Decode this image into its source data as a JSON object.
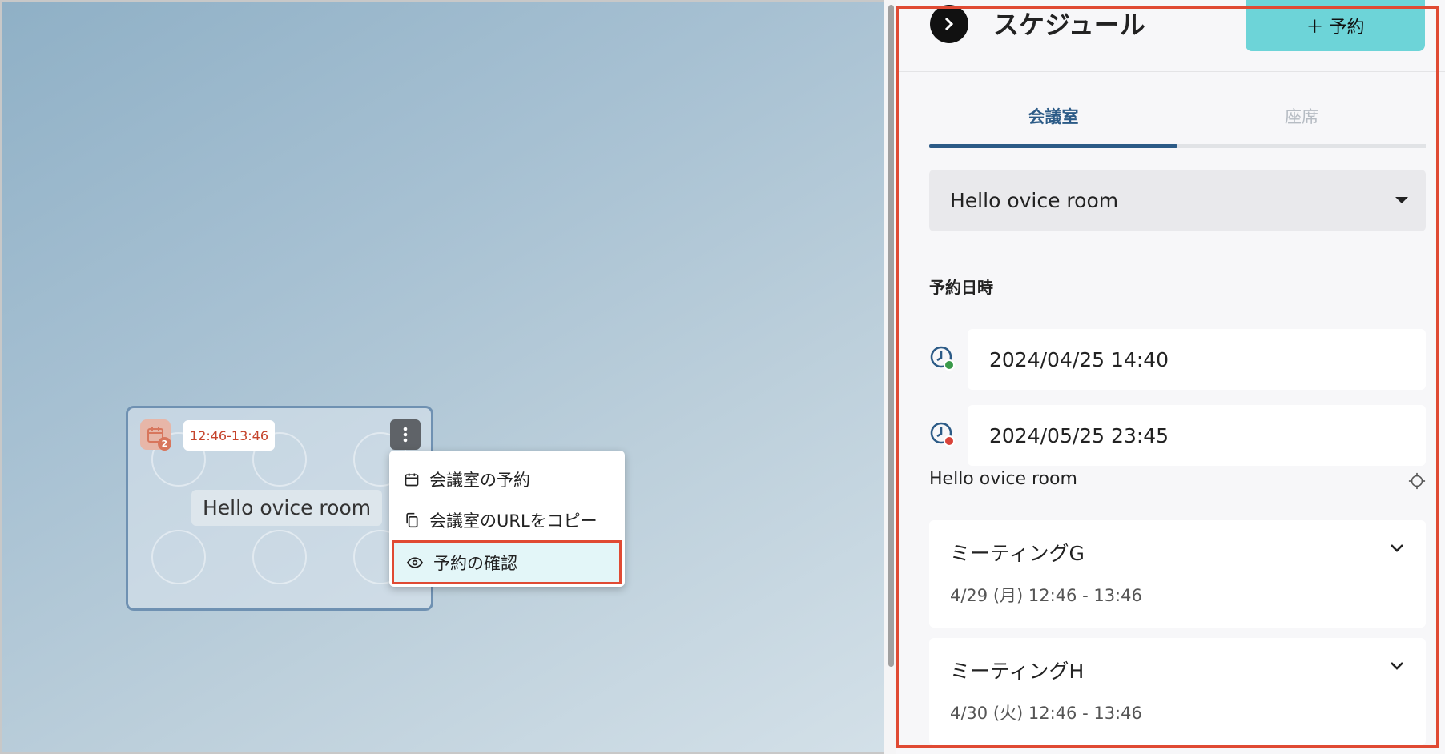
{
  "canvas": {
    "room_card": {
      "badge_count": "2",
      "time_range": "12:46-13:46",
      "room_name": "Hello ovice room"
    },
    "context_menu": {
      "items": [
        {
          "label": "会議室の予約",
          "icon": "calendar-icon"
        },
        {
          "label": "会議室のURLをコピー",
          "icon": "copy-icon"
        },
        {
          "label": "予約の確認",
          "icon": "eye-icon",
          "active": true
        }
      ]
    }
  },
  "panel": {
    "title": "スケジュール",
    "reserve_button": "＋ 予約",
    "tabs": [
      {
        "label": "会議室",
        "active": true
      },
      {
        "label": "座席",
        "active": false
      }
    ],
    "room_select": {
      "value": "Hello ovice room"
    },
    "datetime_label": "予約日時",
    "start_datetime": "2024/04/25 14:40",
    "end_datetime": "2024/05/25 23:45",
    "room_name": "Hello ovice room",
    "meetings": [
      {
        "title": "ミーティングG",
        "time": "4/29 (月) 12:46 - 13:46"
      },
      {
        "title": "ミーティングH",
        "time": "4/30 (火) 12:46 - 13:46"
      }
    ]
  },
  "colors": {
    "accent_teal": "#6dd4d8",
    "tab_active": "#2c5b87",
    "highlight_red": "#e04a33",
    "start_dot": "#3a9a4a",
    "end_dot": "#d9433a"
  }
}
